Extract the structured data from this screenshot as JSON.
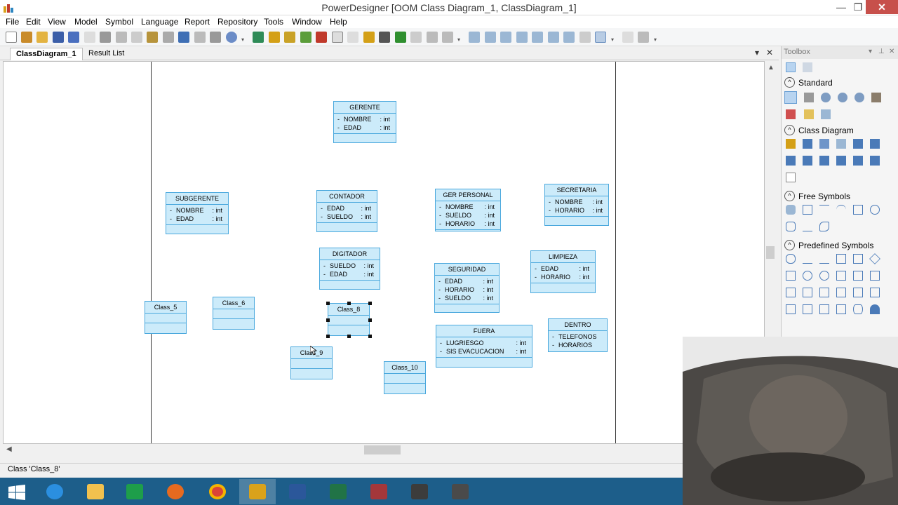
{
  "window": {
    "title": "PowerDesigner [OOM Class Diagram_1, ClassDiagram_1]",
    "minimize_glyph": "—",
    "restore_glyph": "❐",
    "close_glyph": "✕"
  },
  "menu": [
    "File",
    "Edit",
    "View",
    "Model",
    "Symbol",
    "Language",
    "Report",
    "Repository",
    "Tools",
    "Window",
    "Help"
  ],
  "tabs": {
    "active": "ClassDiagram_1",
    "other": "Result List",
    "pin_glyph": "▾",
    "close_glyph": "✕"
  },
  "diagram": {
    "classes": [
      {
        "name": "GERENTE",
        "attrs": [
          {
            "vis": "-",
            "name": "NOMBRE",
            "type": ": int"
          },
          {
            "vis": "-",
            "name": "EDAD",
            "type": ": int"
          }
        ]
      },
      {
        "name": "SUBGERENTE",
        "attrs": [
          {
            "vis": "-",
            "name": "NOMBRE",
            "type": ": int"
          },
          {
            "vis": "-",
            "name": "EDAD",
            "type": ": int"
          }
        ]
      },
      {
        "name": "CONTADOR",
        "attrs": [
          {
            "vis": "-",
            "name": "EDAD",
            "type": ": int"
          },
          {
            "vis": "-",
            "name": "SUELDO",
            "type": ": int"
          }
        ]
      },
      {
        "name": "GER PERSONAL",
        "attrs": [
          {
            "vis": "-",
            "name": "NOMBRE",
            "type": ": int"
          },
          {
            "vis": "-",
            "name": "SUELDO",
            "type": ": int"
          },
          {
            "vis": "-",
            "name": "HORARIO",
            "type": ": int"
          }
        ]
      },
      {
        "name": "SECRETARIA",
        "attrs": [
          {
            "vis": "-",
            "name": "NOMBRE",
            "type": ": int"
          },
          {
            "vis": "-",
            "name": "HORARIO",
            "type": ": int"
          }
        ]
      },
      {
        "name": "DIGITADOR",
        "attrs": [
          {
            "vis": "-",
            "name": "SUELDO",
            "type": ": int"
          },
          {
            "vis": "-",
            "name": "EDAD",
            "type": ": int"
          }
        ]
      },
      {
        "name": "SEGURIDAD",
        "attrs": [
          {
            "vis": "-",
            "name": "EDAD",
            "type": ": int"
          },
          {
            "vis": "-",
            "name": "HORARIO",
            "type": ": int"
          },
          {
            "vis": "-",
            "name": "SUELDO",
            "type": ": int"
          }
        ]
      },
      {
        "name": "LIMPIEZA",
        "attrs": [
          {
            "vis": "-",
            "name": "EDAD",
            "type": ": int"
          },
          {
            "vis": "-",
            "name": "HORARIO",
            "type": ": int"
          }
        ]
      },
      {
        "name": "FUERA",
        "attrs": [
          {
            "vis": "-",
            "name": "LUGRIESGO",
            "type": ": int"
          },
          {
            "vis": "-",
            "name": "SIS EVACUCACION",
            "type": ": int"
          }
        ]
      },
      {
        "name": "DENTRO",
        "attrs": [
          {
            "vis": "-",
            "name": "TELEFONOS",
            "type": ""
          },
          {
            "vis": "-",
            "name": "HORARIOS",
            "type": ""
          }
        ]
      },
      {
        "name": "Class_5",
        "attrs": []
      },
      {
        "name": "Class_6",
        "attrs": []
      },
      {
        "name": "Class_8",
        "attrs": [],
        "selected": true
      },
      {
        "name": "Class_9",
        "attrs": []
      },
      {
        "name": "Class_10",
        "attrs": []
      }
    ]
  },
  "toolbox": {
    "title": "Toolbox",
    "sections": [
      "Standard",
      "Class Diagram",
      "Free Symbols",
      "Predefined Symbols"
    ]
  },
  "status": {
    "text": "Class 'Class_8'"
  },
  "taskbar": {
    "items": [
      "start-icon",
      "internet-explorer-icon",
      "file-explorer-icon",
      "store-icon",
      "firefox-icon",
      "chrome-icon",
      "powerdesigner-icon",
      "word-icon",
      "excel-icon",
      "access-icon",
      "app-icon-1",
      "app-icon-2"
    ]
  },
  "colors": {
    "class_fill": "#ccebfa",
    "class_border": "#4aa8dd",
    "taskbar": "#1d5e8a",
    "close_button": "#c7504b"
  }
}
